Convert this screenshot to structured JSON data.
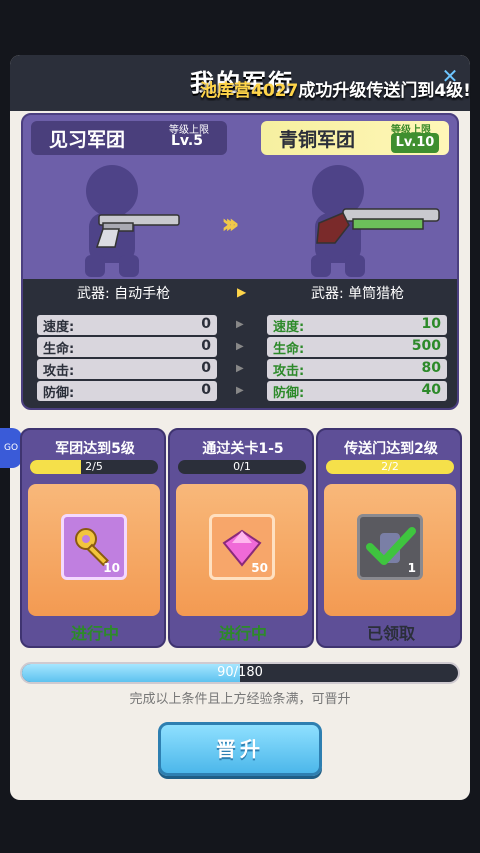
{
  "header": {
    "title": "我的军衔",
    "marquee_player": "池库营4027",
    "marquee_text": "成功升级传送门到4级!"
  },
  "current_corps": {
    "name": "见习军团",
    "level_label": "等级上限",
    "level": "Lv.5",
    "weapon_label": "武器: 自动手枪",
    "stats": [
      {
        "label": "速度:",
        "value": "0"
      },
      {
        "label": "生命:",
        "value": "0"
      },
      {
        "label": "攻击:",
        "value": "0"
      },
      {
        "label": "防御:",
        "value": "0"
      }
    ]
  },
  "next_corps": {
    "name": "青铜军团",
    "level_label": "等级上限",
    "level": "Lv.10",
    "weapon_label": "武器: 单筒猎枪",
    "stats": [
      {
        "label": "速度:",
        "value": "10"
      },
      {
        "label": "生命:",
        "value": "500"
      },
      {
        "label": "攻击:",
        "value": "80"
      },
      {
        "label": "防御:",
        "value": "40"
      }
    ]
  },
  "tasks": [
    {
      "title": "军团达到5级",
      "progress": "2/5",
      "fraction": 0.4,
      "count": "10",
      "item_icon": "key-icon",
      "status": "进行中",
      "status_color": "#2d8a2a"
    },
    {
      "title": "通过关卡1-5",
      "progress": "0/1",
      "fraction": 0.0,
      "count": "50",
      "item_icon": "diamond-icon",
      "status": "进行中",
      "status_color": "#2d8a2a"
    },
    {
      "title": "传送门达到2级",
      "progress": "2/2",
      "fraction": 1.0,
      "count": "1",
      "item_icon": "checkmark-icon",
      "status": "已领取",
      "status_color": "#2b2f3a"
    }
  ],
  "exp": {
    "text": "90/180",
    "fraction": 0.5
  },
  "hint": "完成以上条件且上方经验条满，可晋升",
  "promote_button": "晋升",
  "side_badge": "GO"
}
